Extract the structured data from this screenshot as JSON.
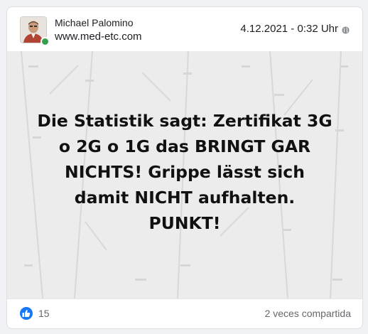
{
  "post": {
    "author_name": "Michael Palomino",
    "author_site": "www.med-etc.com",
    "timestamp": "4.12.2021 - 0:32 Uhr",
    "privacy_icon": "globe-icon",
    "image_text": "Die Statistik sagt: Zertifikat 3G o 2G o 1G das BRINGT GAR NICHTS! Grippe lässt sich damit NICHT aufhalten. PUNKT!",
    "text_lines": [
      "Die Statistik sagt: Zertifikat 3G",
      "o 2G o 1G das BRINGT GAR",
      "NICHTS! Grippe lässt sich",
      "damit NICHT aufhalten.",
      "PUNKT!"
    ],
    "likes": "15",
    "like_icon": "thumbs-up-icon",
    "shares": "2 veces compartida"
  },
  "colors": {
    "like_blue": "#1877f2",
    "online_green": "#31a24c",
    "background_grey": "#ececec"
  }
}
